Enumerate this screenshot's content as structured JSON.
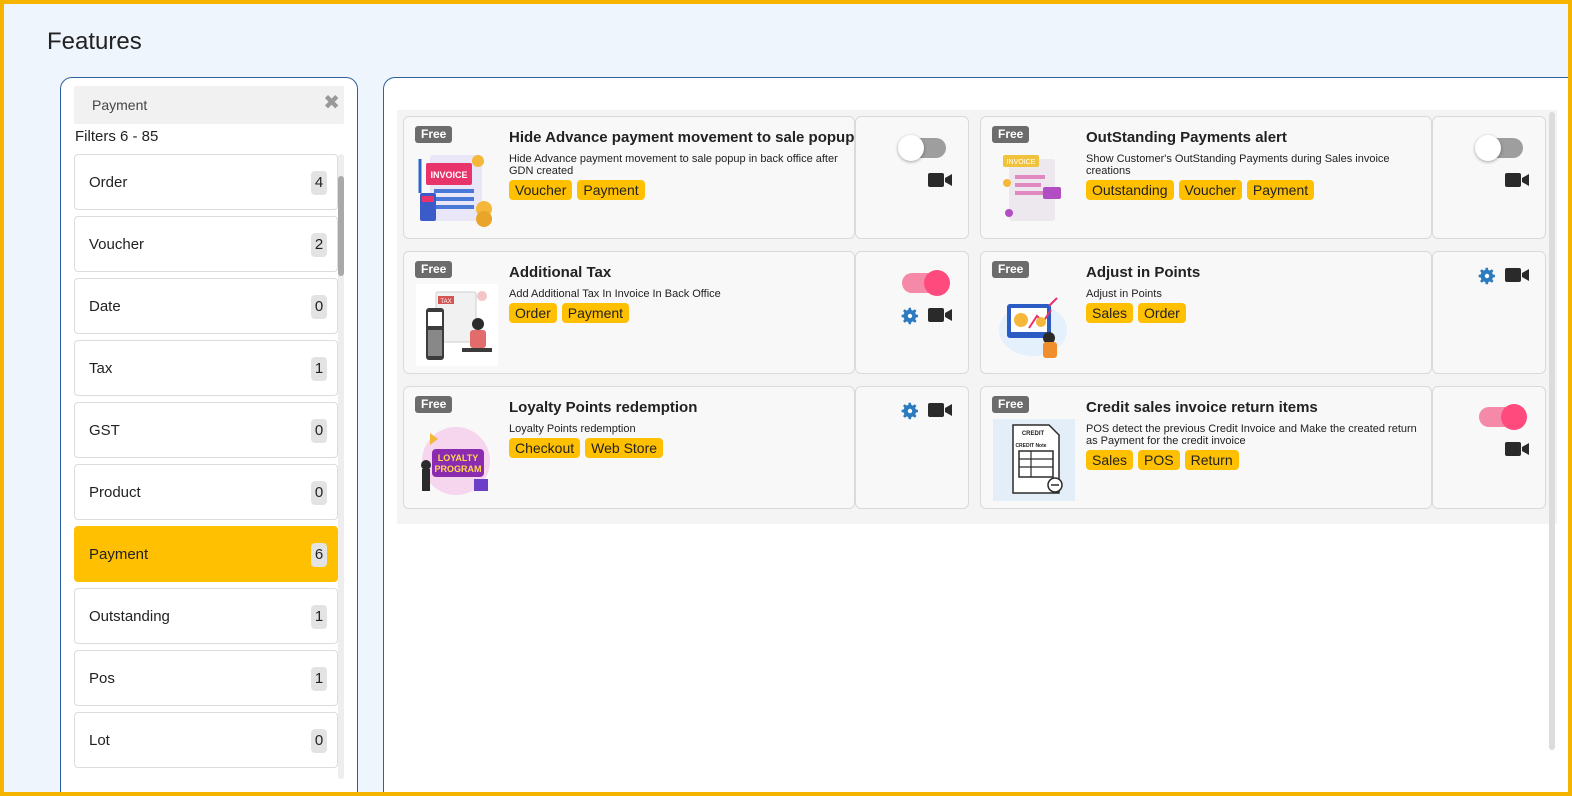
{
  "page": {
    "title": "Features"
  },
  "filter": {
    "search_value": "Payment",
    "clear_symbol": "✖",
    "count_text": "Filters 6 - 85",
    "items": [
      {
        "label": "Order",
        "count": "4",
        "active": false
      },
      {
        "label": "Voucher",
        "count": "2",
        "active": false
      },
      {
        "label": "Date",
        "count": "0",
        "active": false
      },
      {
        "label": "Tax",
        "count": "1",
        "active": false
      },
      {
        "label": "GST",
        "count": "0",
        "active": false
      },
      {
        "label": "Product",
        "count": "0",
        "active": false
      },
      {
        "label": "Payment",
        "count": "6",
        "active": true
      },
      {
        "label": "Outstanding",
        "count": "1",
        "active": false
      },
      {
        "label": "Pos",
        "count": "1",
        "active": false
      },
      {
        "label": "Lot",
        "count": "0",
        "active": false
      }
    ]
  },
  "cards": [
    {
      "badge": "Free",
      "title": "Hide Advance payment movement to sale popup",
      "desc": "Hide Advance payment movement to sale popup in back office after GDN created",
      "tags": [
        "Voucher",
        "Payment"
      ],
      "toggle": "off",
      "settings": false,
      "video": true
    },
    {
      "badge": "Free",
      "title": "OutStanding Payments alert",
      "desc": "Show Customer's OutStanding Payments during Sales invoice creations",
      "tags": [
        "Outstanding",
        "Voucher",
        "Payment"
      ],
      "toggle": "off",
      "settings": false,
      "video": true
    },
    {
      "badge": "Free",
      "title": "Additional Tax",
      "desc": "Add Additional Tax In Invoice In Back Office",
      "tags": [
        "Order",
        "Payment"
      ],
      "toggle": "on",
      "settings": true,
      "video": true
    },
    {
      "badge": "Free",
      "title": "Adjust in Points",
      "desc": "Adjust in Points",
      "tags": [
        "Sales",
        "Order"
      ],
      "toggle": null,
      "settings": true,
      "video": true
    },
    {
      "badge": "Free",
      "title": "Loyalty Points redemption",
      "desc": "Loyalty Points redemption",
      "tags": [
        "Checkout",
        "Web Store"
      ],
      "toggle": null,
      "settings": true,
      "video": true
    },
    {
      "badge": "Free",
      "title": "Credit sales invoice return items",
      "desc": "POS detect the previous Credit Invoice and Make the created return as Payment for the credit invoice",
      "tags": [
        "Sales",
        "POS",
        "Return"
      ],
      "toggle": "on",
      "settings": false,
      "video": true
    }
  ],
  "thumb_text": {
    "invoice": "INVOICE",
    "tax": "TAX",
    "loyalty_line1": "LOYALTY",
    "loyalty_line2": "PROGRAM",
    "credit": "CREDIT",
    "credit_note": "CREDIT Note"
  },
  "colors": {
    "accent": "#fec000",
    "toggle_on": "#ff4a7d",
    "settings_icon": "#2c7bbf",
    "frame": "#f5b400"
  }
}
